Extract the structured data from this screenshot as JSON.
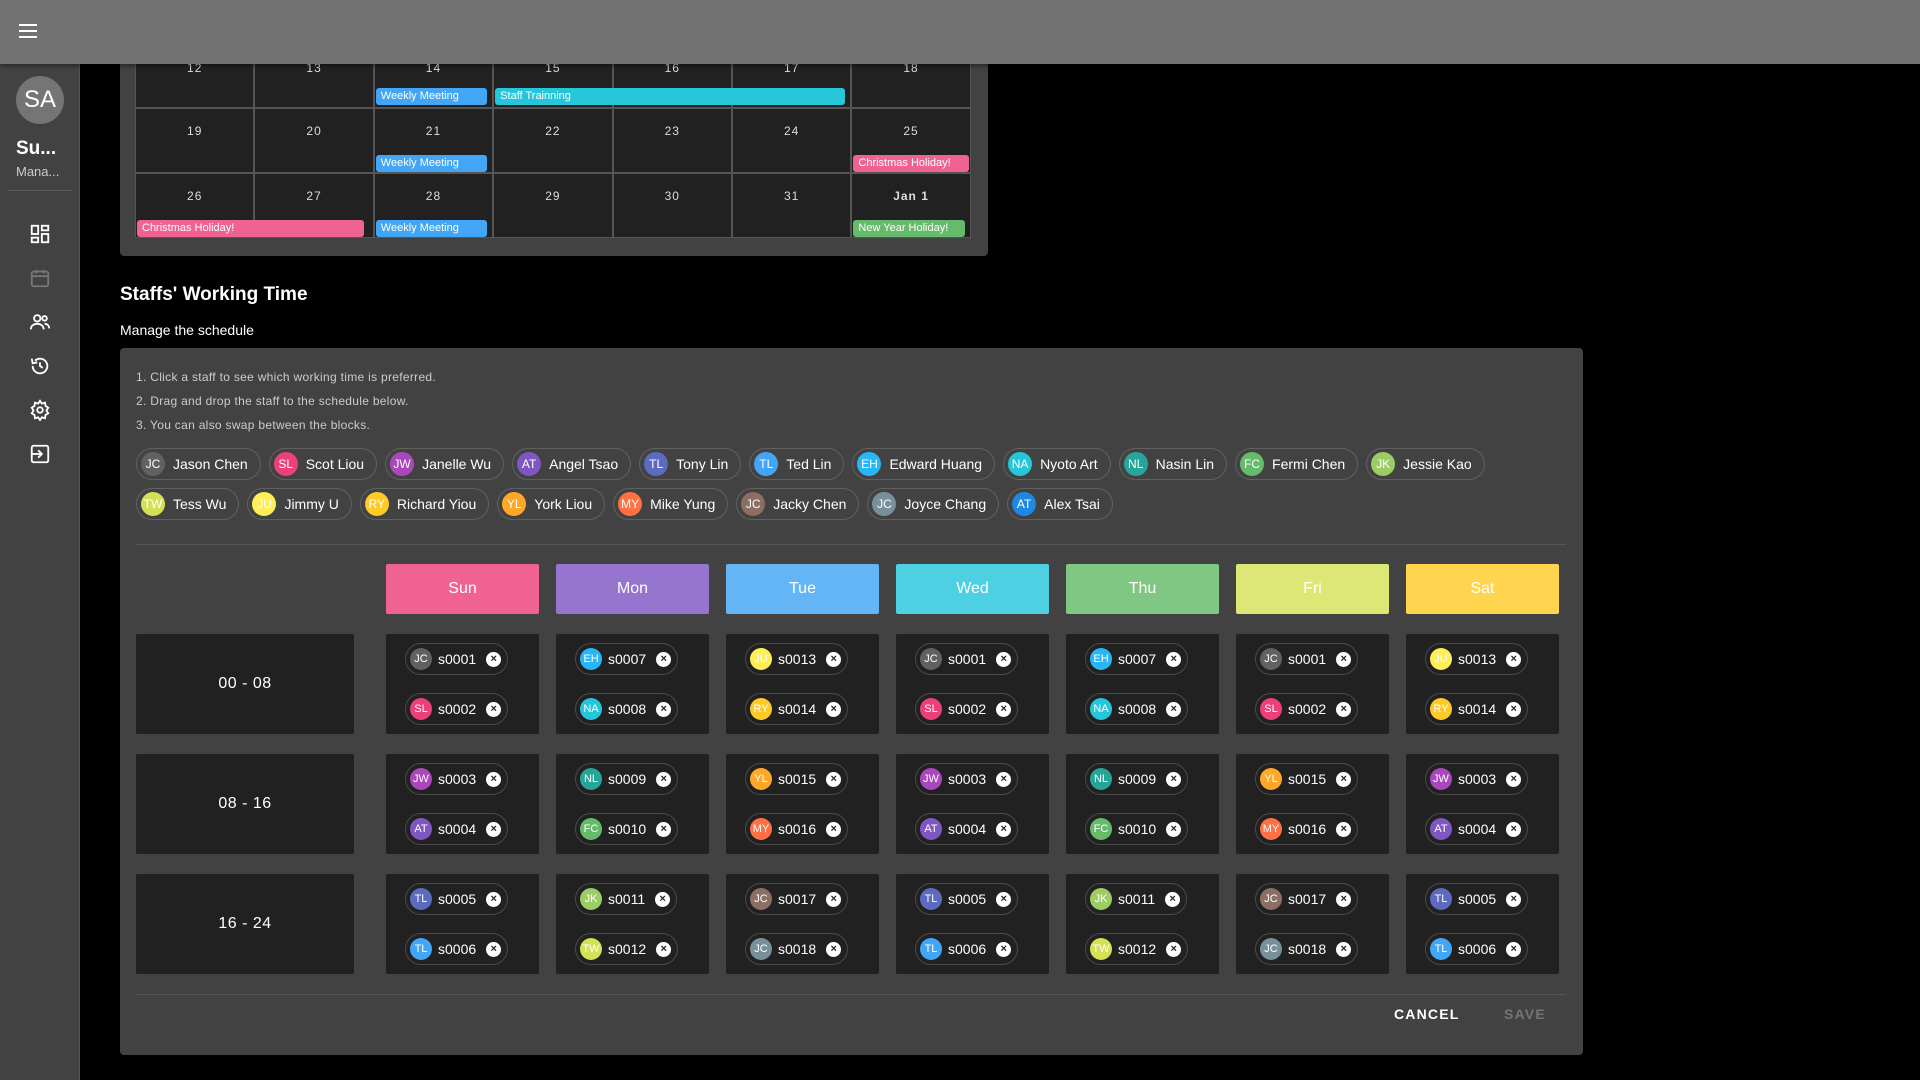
{
  "app": {
    "user_initials": "SA",
    "user_name": "Su...",
    "user_role": "Mana..."
  },
  "calendar": {
    "weeks": [
      {
        "days": [
          "12",
          "13",
          "14",
          "15",
          "16",
          "17",
          "18"
        ],
        "events": [
          {
            "label": "Weekly Meeting",
            "start": 2,
            "span": 1,
            "color": "#42a5f5"
          },
          {
            "label": "Staff Trainning",
            "start": 3,
            "span": 3,
            "color": "#26c6da"
          }
        ]
      },
      {
        "days": [
          "19",
          "20",
          "21",
          "22",
          "23",
          "24",
          "25"
        ],
        "events": [
          {
            "label": "Weekly Meeting",
            "start": 2,
            "span": 1,
            "color": "#42a5f5"
          },
          {
            "label": "Christmas Holiday!",
            "start": 6,
            "span": 1,
            "color": "#f06292"
          }
        ]
      },
      {
        "days": [
          "26",
          "27",
          "28",
          "29",
          "30",
          "31",
          "Jan 1"
        ],
        "events": [
          {
            "label": "Christmas Holiday!",
            "start": 0,
            "span": 2,
            "color": "#f06292"
          },
          {
            "label": "Weekly Meeting",
            "start": 2,
            "span": 1,
            "color": "#42a5f5"
          },
          {
            "label": "New Year Holiday!",
            "start": 6,
            "span": 1,
            "color": "#66bb6a"
          }
        ]
      }
    ]
  },
  "schedule": {
    "title": "Staffs' Working Time",
    "subtitle": "Manage the schedule",
    "instructions": [
      "1. Click a staff to see which working time is preferred.",
      "2. Drag and drop the staff to the schedule below.",
      "3. You can also swap between the blocks."
    ],
    "staff": [
      {
        "initials": "JC",
        "name": "Jason Chen",
        "color": "#616161"
      },
      {
        "initials": "SL",
        "name": "Scot Liou",
        "color": "#ec407a"
      },
      {
        "initials": "JW",
        "name": "Janelle Wu",
        "color": "#ab47bc"
      },
      {
        "initials": "AT",
        "name": "Angel Tsao",
        "color": "#7e57c2"
      },
      {
        "initials": "TL",
        "name": "Tony Lin",
        "color": "#5c6bc0"
      },
      {
        "initials": "TL",
        "name": "Ted Lin",
        "color": "#42a5f5"
      },
      {
        "initials": "EH",
        "name": "Edward Huang",
        "color": "#29b6f6"
      },
      {
        "initials": "NA",
        "name": "Nyoto Art",
        "color": "#26c6da"
      },
      {
        "initials": "NL",
        "name": "Nasin Lin",
        "color": "#26a69a"
      },
      {
        "initials": "FC",
        "name": "Fermi Chen",
        "color": "#66bb6a"
      },
      {
        "initials": "JK",
        "name": "Jessie Kao",
        "color": "#9ccc65"
      },
      {
        "initials": "TW",
        "name": "Tess Wu",
        "color": "#d4e157"
      },
      {
        "initials": "JU",
        "name": "Jimmy U",
        "color": "#ffee58"
      },
      {
        "initials": "RY",
        "name": "Richard Yiou",
        "color": "#ffca28"
      },
      {
        "initials": "YL",
        "name": "York Liou",
        "color": "#ffa726"
      },
      {
        "initials": "MY",
        "name": "Mike Yung",
        "color": "#ff7043"
      },
      {
        "initials": "JC",
        "name": "Jacky Chen",
        "color": "#8d6e63"
      },
      {
        "initials": "JC",
        "name": "Joyce Chang",
        "color": "#78909c"
      },
      {
        "initials": "AT",
        "name": "Alex Tsai",
        "color": "#1e88e5"
      }
    ],
    "days": [
      {
        "label": "Sun",
        "color": "#f06292"
      },
      {
        "label": "Mon",
        "color": "#9575cd"
      },
      {
        "label": "Tue",
        "color": "#64b5f6"
      },
      {
        "label": "Wed",
        "color": "#4dd0e1"
      },
      {
        "label": "Thu",
        "color": "#81c784"
      },
      {
        "label": "Fri",
        "color": "#dce775"
      },
      {
        "label": "Sat",
        "color": "#ffd54f"
      }
    ],
    "slots": [
      {
        "label": "00 - 08",
        "cells": [
          [
            {
              "i": "JC",
              "id": "s0001",
              "c": "#616161"
            },
            {
              "i": "SL",
              "id": "s0002",
              "c": "#ec407a"
            }
          ],
          [
            {
              "i": "EH",
              "id": "s0007",
              "c": "#29b6f6"
            },
            {
              "i": "NA",
              "id": "s0008",
              "c": "#26c6da"
            }
          ],
          [
            {
              "i": "JU",
              "id": "s0013",
              "c": "#ffee58"
            },
            {
              "i": "RY",
              "id": "s0014",
              "c": "#ffca28"
            }
          ],
          [
            {
              "i": "JC",
              "id": "s0001",
              "c": "#616161"
            },
            {
              "i": "SL",
              "id": "s0002",
              "c": "#ec407a"
            }
          ],
          [
            {
              "i": "EH",
              "id": "s0007",
              "c": "#29b6f6"
            },
            {
              "i": "NA",
              "id": "s0008",
              "c": "#26c6da"
            }
          ],
          [
            {
              "i": "JC",
              "id": "s0001",
              "c": "#616161"
            },
            {
              "i": "SL",
              "id": "s0002",
              "c": "#ec407a"
            }
          ],
          [
            {
              "i": "JU",
              "id": "s0013",
              "c": "#ffee58"
            },
            {
              "i": "RY",
              "id": "s0014",
              "c": "#ffca28"
            }
          ]
        ]
      },
      {
        "label": "08 - 16",
        "cells": [
          [
            {
              "i": "JW",
              "id": "s0003",
              "c": "#ab47bc"
            },
            {
              "i": "AT",
              "id": "s0004",
              "c": "#7e57c2"
            }
          ],
          [
            {
              "i": "NL",
              "id": "s0009",
              "c": "#26a69a"
            },
            {
              "i": "FC",
              "id": "s0010",
              "c": "#66bb6a"
            }
          ],
          [
            {
              "i": "YL",
              "id": "s0015",
              "c": "#ffa726"
            },
            {
              "i": "MY",
              "id": "s0016",
              "c": "#ff7043"
            }
          ],
          [
            {
              "i": "JW",
              "id": "s0003",
              "c": "#ab47bc"
            },
            {
              "i": "AT",
              "id": "s0004",
              "c": "#7e57c2"
            }
          ],
          [
            {
              "i": "NL",
              "id": "s0009",
              "c": "#26a69a"
            },
            {
              "i": "FC",
              "id": "s0010",
              "c": "#66bb6a"
            }
          ],
          [
            {
              "i": "YL",
              "id": "s0015",
              "c": "#ffa726"
            },
            {
              "i": "MY",
              "id": "s0016",
              "c": "#ff7043"
            }
          ],
          [
            {
              "i": "JW",
              "id": "s0003",
              "c": "#ab47bc"
            },
            {
              "i": "AT",
              "id": "s0004",
              "c": "#7e57c2"
            }
          ]
        ]
      },
      {
        "label": "16 - 24",
        "cells": [
          [
            {
              "i": "TL",
              "id": "s0005",
              "c": "#5c6bc0"
            },
            {
              "i": "TL",
              "id": "s0006",
              "c": "#42a5f5"
            }
          ],
          [
            {
              "i": "JK",
              "id": "s0011",
              "c": "#9ccc65"
            },
            {
              "i": "TW",
              "id": "s0012",
              "c": "#d4e157"
            }
          ],
          [
            {
              "i": "JC",
              "id": "s0017",
              "c": "#8d6e63"
            },
            {
              "i": "JC",
              "id": "s0018",
              "c": "#78909c"
            }
          ],
          [
            {
              "i": "TL",
              "id": "s0005",
              "c": "#5c6bc0"
            },
            {
              "i": "TL",
              "id": "s0006",
              "c": "#42a5f5"
            }
          ],
          [
            {
              "i": "JK",
              "id": "s0011",
              "c": "#9ccc65"
            },
            {
              "i": "TW",
              "id": "s0012",
              "c": "#d4e157"
            }
          ],
          [
            {
              "i": "JC",
              "id": "s0017",
              "c": "#8d6e63"
            },
            {
              "i": "JC",
              "id": "s0018",
              "c": "#78909c"
            }
          ],
          [
            {
              "i": "TL",
              "id": "s0005",
              "c": "#5c6bc0"
            },
            {
              "i": "TL",
              "id": "s0006",
              "c": "#42a5f5"
            }
          ]
        ]
      }
    ],
    "cancel_label": "CANCEL",
    "save_label": "SAVE"
  },
  "colors": {
    "appbar": "#727272",
    "sidebar": "#424242",
    "card": "#424242",
    "cell": "#212121",
    "save_disabled": "#757575"
  }
}
